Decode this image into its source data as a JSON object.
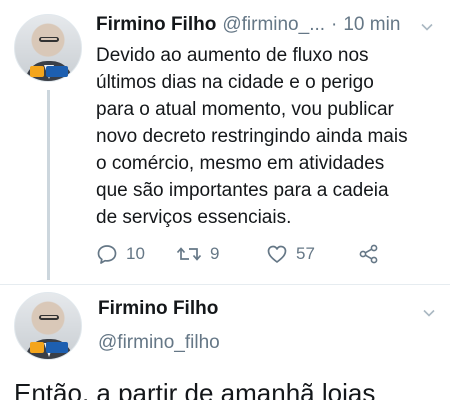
{
  "tweet": {
    "author_name": "Firmino Filho",
    "author_handle": "@firmino_...",
    "separator": "·",
    "time": "10 min",
    "text": "Devido ao aumento de fluxo nos\núltimos dias na cidade e o perigo\npara o atual momento, vou publicar\nnovo decreto restringindo ainda mais\no comércio, mesmo em atividades\nque são importantes para a cadeia\nde serviços essenciais.",
    "replies": "10",
    "retweets": "9",
    "likes": "57"
  },
  "detail": {
    "author_name": "Firmino Filho",
    "author_handle": "@firmino_filho",
    "text_partial": "Então, a partir de amanhã lojas"
  },
  "colors": {
    "text": "#14171a",
    "secondary": "#657786",
    "thread_line": "#ccd6dd",
    "divider": "#e6ecf0"
  },
  "icons": [
    "chevron-down-icon",
    "reply-icon",
    "retweet-icon",
    "like-icon",
    "share-icon"
  ]
}
